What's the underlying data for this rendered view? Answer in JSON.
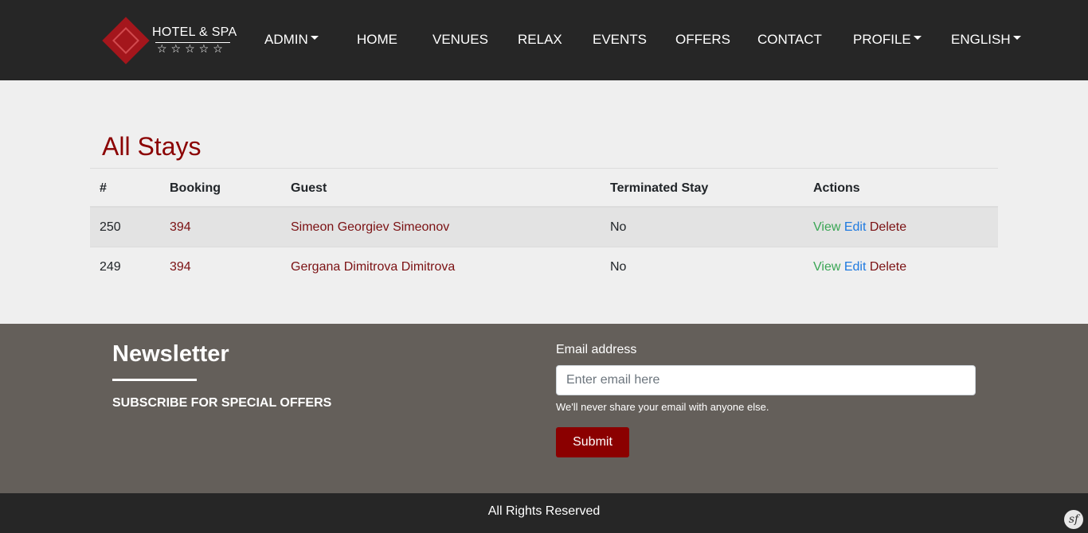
{
  "header": {
    "brand": {
      "name": "HOTEL & SPA",
      "stars": "☆☆☆☆☆"
    },
    "nav": {
      "admin": "ADMIN",
      "home": "HOME",
      "venues": "VENUES",
      "relax": "RELAX",
      "events": "EVENTS",
      "offers": "OFFERS",
      "contact": "CONTACT",
      "profile": "PROFILE",
      "language": "ENGLISH"
    }
  },
  "main": {
    "title": "All Stays",
    "table": {
      "columns": [
        "#",
        "Booking",
        "Guest",
        "Terminated Stay",
        "Actions"
      ],
      "rows": [
        {
          "id": "250",
          "booking": "394",
          "guest": "Simeon Georgiev Simeonov",
          "terminated": "No",
          "view": "View",
          "edit": "Edit",
          "delete": "Delete"
        },
        {
          "id": "249",
          "booking": "394",
          "guest": "Gergana Dimitrova Dimitrova",
          "terminated": "No",
          "view": "View",
          "edit": "Edit",
          "delete": "Delete"
        }
      ]
    }
  },
  "newsletter": {
    "title": "Newsletter",
    "subtitle": "SUBSCRIBE FOR SPECIAL OFFERS",
    "email_label": "Email address",
    "email_placeholder": "Enter email here",
    "email_value": "",
    "help_text": "We'll never share your email with anyone else.",
    "submit_label": "Submit"
  },
  "footer": {
    "rights": "All Rights Reserved",
    "badge": "sf"
  },
  "colors": {
    "navbar": "#262626",
    "accent": "#8b0000",
    "newsletter_bg": "#645f5a",
    "view_link": "#3aa655",
    "edit_link": "#1e7ae0"
  }
}
